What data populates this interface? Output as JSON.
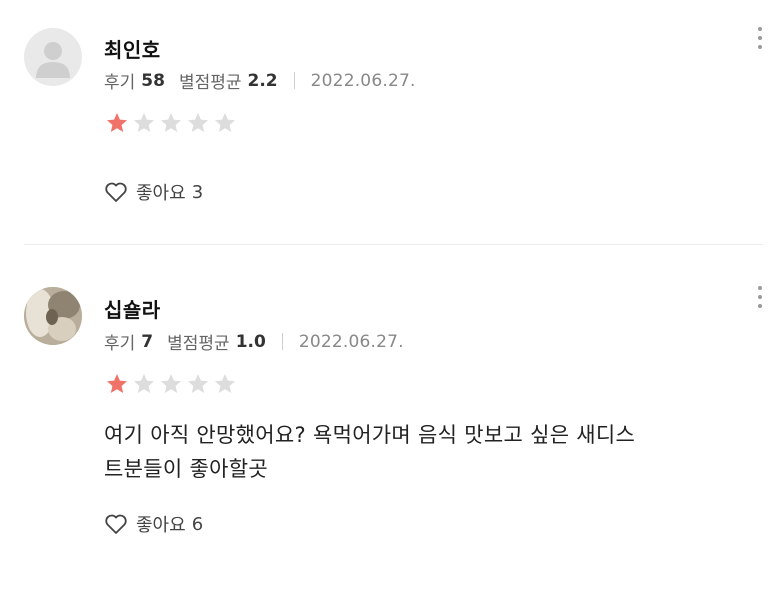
{
  "reviews": [
    {
      "name": "최인호",
      "review_label": "후기",
      "review_count": "58",
      "avg_label": "별점평균",
      "avg_rating": "2.2",
      "date": "2022.06.27.",
      "rating": 1,
      "max_rating": 5,
      "text": "",
      "like_label": "좋아요",
      "like_count": "3"
    },
    {
      "name": "십숄라",
      "review_label": "후기",
      "review_count": "7",
      "avg_label": "별점평균",
      "avg_rating": "1.0",
      "date": "2022.06.27.",
      "rating": 1,
      "max_rating": 5,
      "text_line1": "여기 아직 안망했어요? 욕먹어가며 음식 맛보고 싶은 새디스",
      "text_line2": "트분들이 좋아할곳",
      "like_label": "좋아요",
      "like_count": "6"
    }
  ],
  "colors": {
    "star_on": "#f0736a",
    "star_off": "#dddddd"
  }
}
